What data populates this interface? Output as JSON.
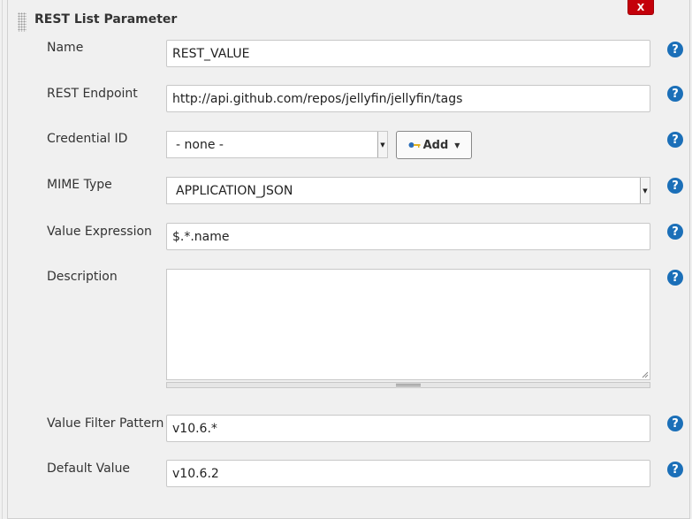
{
  "header": {
    "title": "REST List Parameter",
    "close_label": "X"
  },
  "fields": {
    "name": {
      "label": "Name",
      "value": "REST_VALUE"
    },
    "rest_endpoint": {
      "label": "REST Endpoint",
      "value": "http://api.github.com/repos/jellyfin/jellyfin/tags"
    },
    "credential_id": {
      "label": "Credential ID",
      "selected": "- none -",
      "add_label": "Add"
    },
    "mime_type": {
      "label": "MIME Type",
      "selected": "APPLICATION_JSON"
    },
    "value_expression": {
      "label": "Value Expression",
      "value": "$.*.name"
    },
    "description": {
      "label": "Description",
      "value": ""
    },
    "value_filter_pattern": {
      "label": "Value Filter Pattern",
      "value": "v10.6.*"
    },
    "default_value": {
      "label": "Default Value",
      "value": "v10.6.2"
    }
  },
  "help_label": "?",
  "colors": {
    "close_button": "#c4000a",
    "help_icon": "#1b6fb8",
    "background": "#f0f0f0"
  },
  "icons": [
    "drag-handle-icon",
    "close-icon",
    "help-icon",
    "key-icon",
    "caret-down-icon",
    "resize-handle-icon"
  ]
}
